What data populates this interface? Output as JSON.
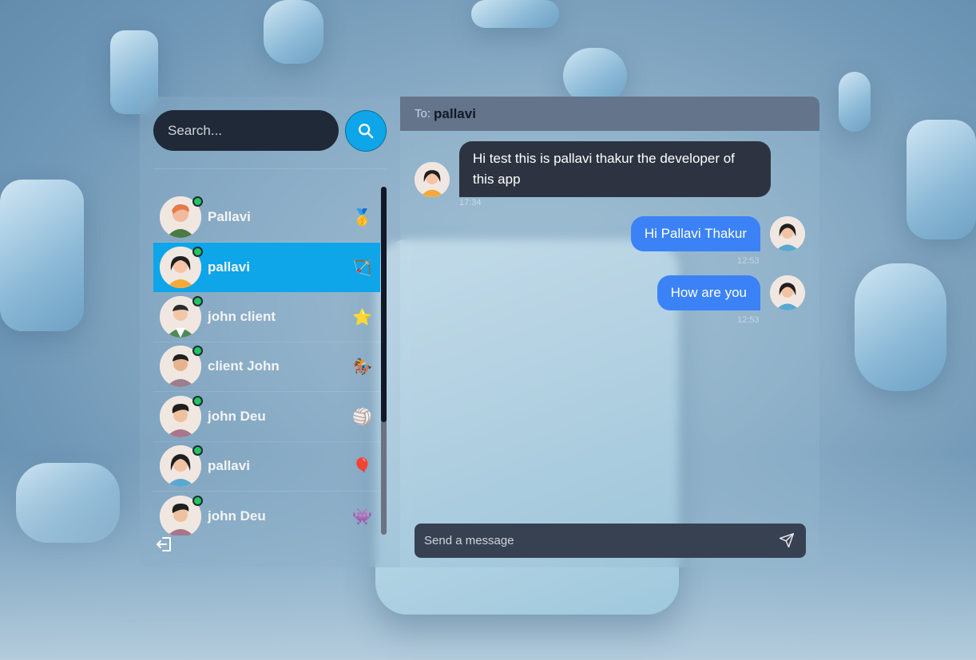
{
  "search": {
    "placeholder": "Search..."
  },
  "contacts": [
    {
      "name": "Pallavi",
      "emoji": "🥇",
      "online": true,
      "active": false
    },
    {
      "name": "pallavi",
      "emoji": "🏹",
      "online": true,
      "active": true
    },
    {
      "name": "john client",
      "emoji": "⭐",
      "online": true,
      "active": false
    },
    {
      "name": "client John",
      "emoji": "🏇",
      "online": true,
      "active": false
    },
    {
      "name": "john Deu",
      "emoji": "🏐",
      "online": true,
      "active": false
    },
    {
      "name": "pallavi",
      "emoji": "🎈",
      "online": true,
      "active": false
    },
    {
      "name": "john Deu",
      "emoji": "👾",
      "online": true,
      "active": false
    }
  ],
  "chat": {
    "to_label": "To:",
    "to_name": "pallavi",
    "messages": [
      {
        "direction": "in",
        "text": "Hi test this is pallavi thakur the developer of this app",
        "time": "17:34"
      },
      {
        "direction": "out",
        "text": "Hi Pallavi Thakur",
        "time": "12:53"
      },
      {
        "direction": "out",
        "text": "How are you",
        "time": "12:53"
      }
    ],
    "composer_placeholder": "Send a message"
  },
  "colors": {
    "accent": "#0ea5e9",
    "outgoing_bubble": "#3b82f6",
    "incoming_bubble": "#2d3340",
    "online": "#22c55e"
  },
  "icons": {
    "search": "search-icon",
    "logout": "logout-icon",
    "send": "send-icon"
  }
}
